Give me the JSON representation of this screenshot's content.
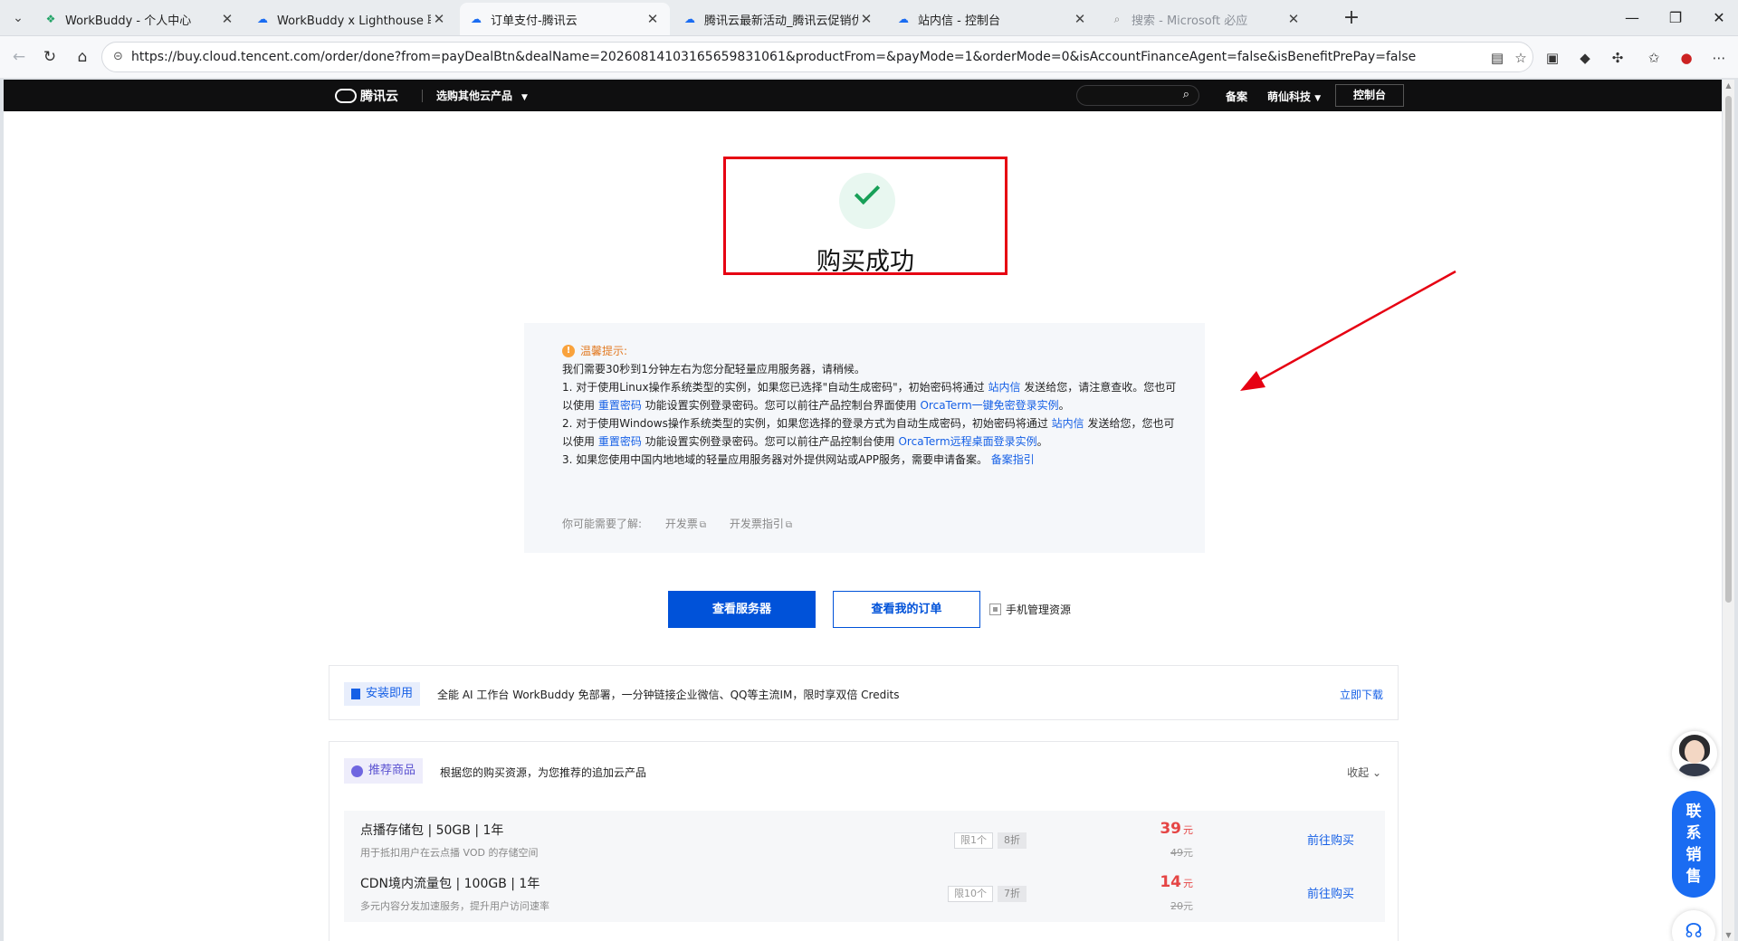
{
  "browser": {
    "tabs": [
      {
        "title": "WorkBuddy - 个人中心",
        "favicon": "workbuddy-icon",
        "active": false,
        "muted": false
      },
      {
        "title": "WorkBuddy x Lighthouse 联合解决",
        "favicon": "tencent-cloud-icon",
        "active": false,
        "muted": false
      },
      {
        "title": "订单支付-腾讯云",
        "favicon": "tencent-cloud-icon",
        "active": true,
        "muted": false
      },
      {
        "title": "腾讯云最新活动_腾讯云促销优惠_(",
        "favicon": "tencent-cloud-icon",
        "active": false,
        "muted": false
      },
      {
        "title": "站内信 - 控制台",
        "favicon": "tencent-cloud-icon",
        "active": false,
        "muted": false
      },
      {
        "title": "搜索 - Microsoft 必应",
        "favicon": "search-icon",
        "active": false,
        "muted": true
      }
    ],
    "url": "https://buy.cloud.tencent.com/order/done?from=payDealBtn&dealName=20260814103165659831061&productFrom=&payMode=1&orderMode=0&isAccountFinanceAgent=false&isBenefitPrePay=false"
  },
  "topbar": {
    "logo": "腾讯云",
    "products_menu": "选购其他云产品",
    "links": {
      "beian": "备案",
      "account": "萌仙科技"
    },
    "console_button": "控制台"
  },
  "success": {
    "title": "购买成功"
  },
  "notice": {
    "heading": "温馨提示:",
    "lines": [
      {
        "parts": [
          {
            "t": "我们需要30秒到1分钟左右为您分配轻量应用服务器，请稍候。"
          }
        ]
      },
      {
        "parts": [
          {
            "t": "1. 对于使用Linux操作系统类型的实例，如果您已选择\"自动生成密码\"，初始密码将通过 "
          },
          {
            "t": "站内信",
            "link": true
          },
          {
            "t": " 发送给您，请注意查收。您也可"
          }
        ]
      },
      {
        "parts": [
          {
            "t": "以使用 "
          },
          {
            "t": "重置密码",
            "link": true
          },
          {
            "t": " 功能设置实例登录密码。您可以前往产品控制台界面使用 "
          },
          {
            "t": "OrcaTerm一键免密登录实例",
            "link": true
          },
          {
            "t": "。"
          }
        ]
      },
      {
        "parts": [
          {
            "t": "2. 对于使用Windows操作系统类型的实例，如果您选择的登录方式为自动生成密码，初始密码将通过 "
          },
          {
            "t": "站内信",
            "link": true
          },
          {
            "t": " 发送给您，您也可"
          }
        ]
      },
      {
        "parts": [
          {
            "t": "以使用 "
          },
          {
            "t": "重置密码",
            "link": true
          },
          {
            "t": " 功能设置实例登录密码。您可以前往产品控制台使用 "
          },
          {
            "t": "OrcaTerm远程桌面登录实例",
            "link": true
          },
          {
            "t": "。"
          }
        ]
      },
      {
        "parts": [
          {
            "t": "3. 如果您使用中国内地地域的轻量应用服务器对外提供网站或APP服务，需要申请备案。 "
          },
          {
            "t": "备案指引",
            "link": true
          }
        ]
      }
    ],
    "footer_label": "你可能需要了解:",
    "footer_links": [
      "开发票",
      "开发票指引"
    ]
  },
  "actions": {
    "view_servers": "查看服务器",
    "view_orders": "查看我的订单",
    "mobile_manage": "手机管理资源"
  },
  "install": {
    "tag": "安装即用",
    "text": "全能 AI 工作台 WorkBuddy 免部署，一分钟链接企业微信、QQ等主流IM，限时享双倍 Credits",
    "link": "立即下载"
  },
  "recommend": {
    "tag": "推荐商品",
    "desc": "根据您的购买资源，为您推荐的追加云产品",
    "collapse": "收起",
    "products": [
      {
        "name": "点播存储包 | 50GB | 1年",
        "desc": "用于抵扣用户在云点播 VOD 的存储空间",
        "limit": "限1个",
        "discount": "8折",
        "price": "39",
        "unit": "元",
        "old_price": "49",
        "old_unit": "元",
        "buy": "前往购买"
      },
      {
        "name": "CDN境内流量包 | 100GB | 1年",
        "desc": "多元内容分发加速服务，提升用户访问速率",
        "limit": "限10个",
        "discount": "7折",
        "price": "14",
        "unit": "元",
        "old_price": "20",
        "old_unit": "元",
        "buy": "前往购买"
      }
    ]
  },
  "float": {
    "contact_sales": [
      "联",
      "系",
      "销",
      "售"
    ]
  },
  "colors": {
    "brand_blue": "#0052d9",
    "link_blue": "#1660e6",
    "success_green": "#18a058",
    "highlight_red": "#e60012",
    "price_red": "#e54545"
  }
}
